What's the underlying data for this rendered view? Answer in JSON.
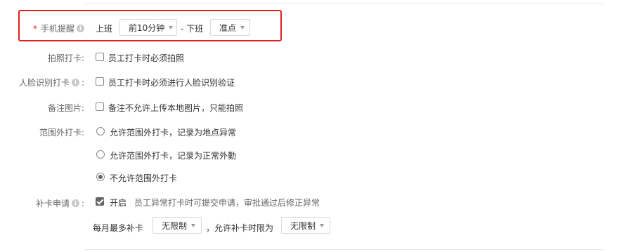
{
  "phone_reminder": {
    "required_mark": "*",
    "label": "手机提醒",
    "info_icon": "info-icon",
    "start_label": "上班",
    "start_value": "前10分钟",
    "separator": "- 下班",
    "end_value": "准点"
  },
  "photo_checkin": {
    "label": "拍照打卡:",
    "option": "员工打卡时必须拍照",
    "checked": false
  },
  "face_checkin": {
    "label": "人脸识别打卡",
    "colon": ":",
    "info_icon": "info-icon",
    "option": "员工打卡时必须进行人脸识别验证",
    "checked": false
  },
  "note_image": {
    "label": "备注图片:",
    "option": "备注不允许上传本地图片，只能拍照",
    "checked": false
  },
  "out_of_range": {
    "label": "范围外打卡:",
    "options": [
      "允许范围外打卡，记录为地点异常",
      "允许范围外打卡，记录为正常外勤",
      "不允许范围外打卡"
    ],
    "selected_index": 2
  },
  "makeup_request": {
    "label": "补卡申请",
    "colon": ":",
    "info_icon": "info-icon",
    "toggle_label": "开启",
    "checked": true,
    "description": "员工异常打卡时可提交申请，审批通过后修正异常",
    "monthly_label": "每月最多补卡",
    "monthly_value": "无限制",
    "limit_label": "，允许补卡时限为",
    "limit_value": "无限制"
  },
  "colors": {
    "highlight_border": "#e02020",
    "required_mark": "#e02020",
    "checked_control": "#666666"
  }
}
